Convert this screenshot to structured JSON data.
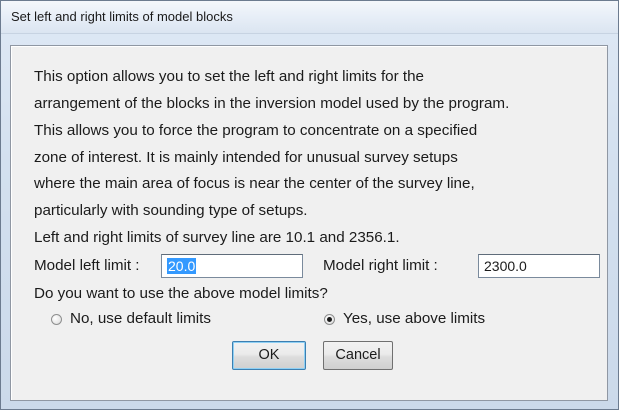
{
  "window": {
    "title": "Set left and right limits of model blocks"
  },
  "description": {
    "lines": [
      "This option allows you to set the left and right limits for the",
      "arrangement of the blocks in the inversion model used by the program.",
      "This allows you to force the program to concentrate on a specified",
      "zone of interest. It is mainly intended for unusual survey setups",
      "where the main area of focus is near the center of the survey line,",
      "particularly with sounding type of setups.",
      "Left and right limits of survey line are 10.1 and 2356.1."
    ]
  },
  "fields": {
    "left_label": "Model left limit :",
    "left_value": "20.0",
    "right_label": "Model right limit :",
    "right_value": "2300.0"
  },
  "question": "Do you want to use the above model limits?",
  "options": {
    "no_label": "No, use default limits",
    "no_selected": false,
    "yes_label": "Yes, use  above limits",
    "yes_selected": true
  },
  "buttons": {
    "ok_label": "OK",
    "cancel_label": "Cancel"
  }
}
